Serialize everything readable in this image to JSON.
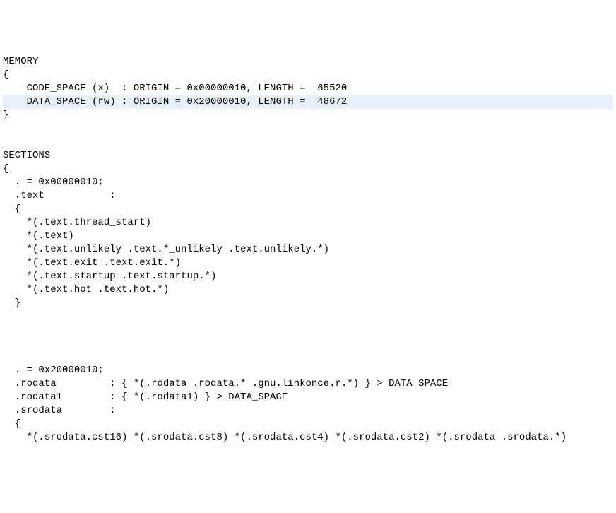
{
  "lines": [
    {
      "text": "MEMORY",
      "hl": false
    },
    {
      "text": "{",
      "hl": false
    },
    {
      "text": "    CODE_SPACE (x)  : ORIGIN = 0x00000010, LENGTH =  65520",
      "hl": false
    },
    {
      "text": "    DATA_SPACE (rw) : ORIGIN = 0x20000010, LENGTH =  48672",
      "hl": true
    },
    {
      "text": "}",
      "hl": false
    },
    {
      "text": "",
      "hl": false
    },
    {
      "text": "",
      "hl": false
    },
    {
      "text": "SECTIONS",
      "hl": false
    },
    {
      "text": "{",
      "hl": false
    },
    {
      "text": "  . = 0x00000010;",
      "hl": false
    },
    {
      "text": "  .text           :",
      "hl": false
    },
    {
      "text": "  {",
      "hl": false
    },
    {
      "text": "    *(.text.thread_start)",
      "hl": false
    },
    {
      "text": "    *(.text)",
      "hl": false
    },
    {
      "text": "    *(.text.unlikely .text.*_unlikely .text.unlikely.*)",
      "hl": false
    },
    {
      "text": "    *(.text.exit .text.exit.*)",
      "hl": false
    },
    {
      "text": "    *(.text.startup .text.startup.*)",
      "hl": false
    },
    {
      "text": "    *(.text.hot .text.hot.*)",
      "hl": false
    },
    {
      "text": "  }",
      "hl": false
    },
    {
      "text": "",
      "hl": false
    },
    {
      "text": "",
      "hl": false
    },
    {
      "text": "",
      "hl": false
    },
    {
      "text": "",
      "hl": false
    },
    {
      "text": "  . = 0x20000010;",
      "hl": false
    },
    {
      "text": "  .rodata         : { *(.rodata .rodata.* .gnu.linkonce.r.*) } > DATA_SPACE",
      "hl": false
    },
    {
      "text": "  .rodata1        : { *(.rodata1) } > DATA_SPACE",
      "hl": false
    },
    {
      "text": "  .srodata        :",
      "hl": false
    },
    {
      "text": "  {",
      "hl": false
    },
    {
      "text": "    *(.srodata.cst16) *(.srodata.cst8) *(.srodata.cst4) *(.srodata.cst2) *(.srodata .srodata.*)",
      "hl": false
    }
  ]
}
